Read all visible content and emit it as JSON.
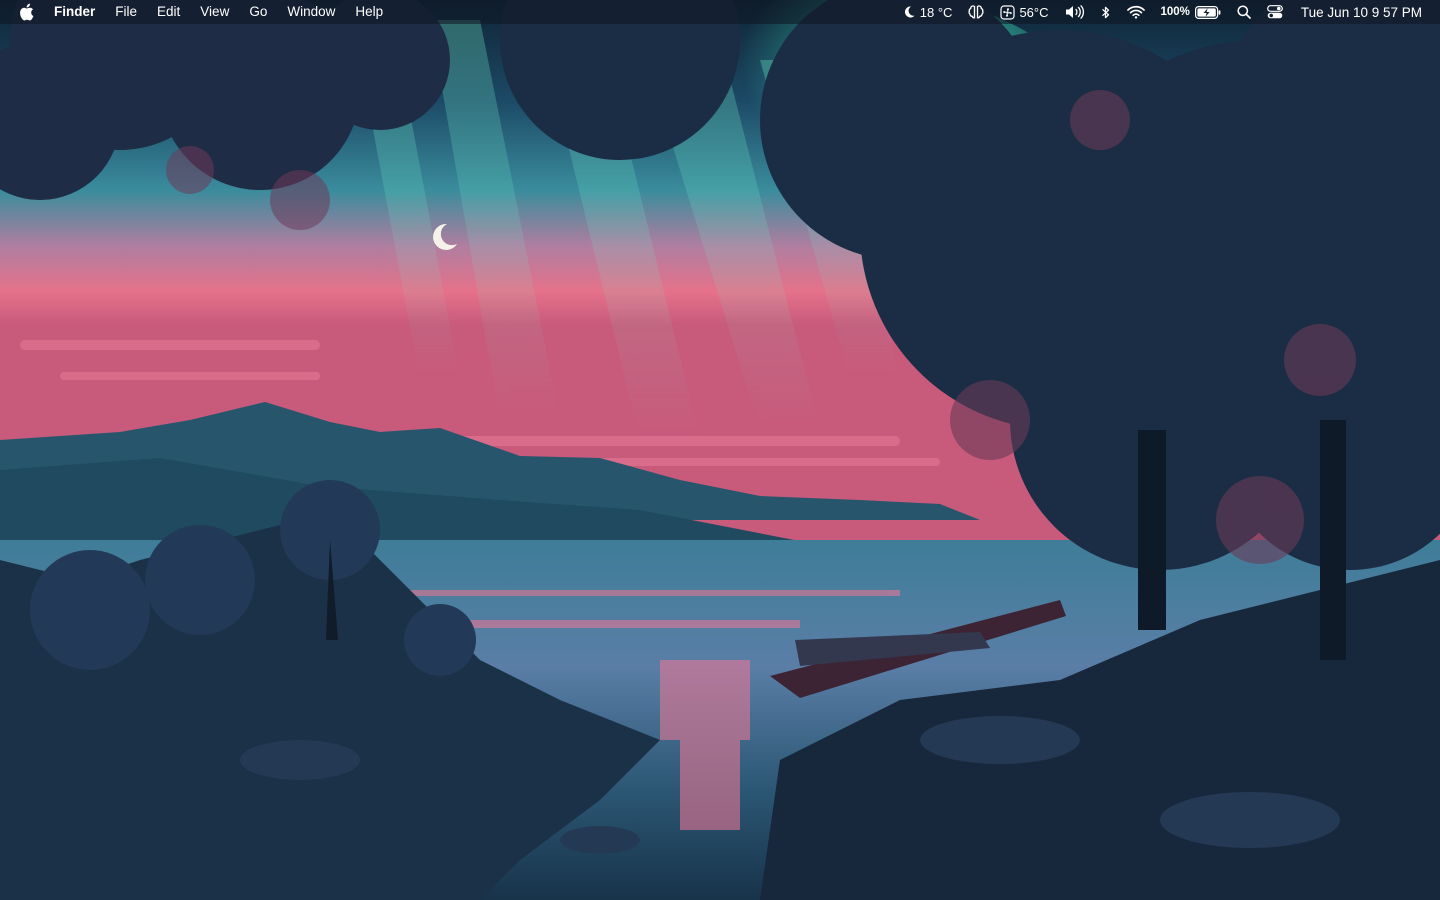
{
  "menubar": {
    "app_name": "Finder",
    "menus": [
      "File",
      "Edit",
      "View",
      "Go",
      "Window",
      "Help"
    ],
    "status": {
      "weather": {
        "icon": "moon-weather-icon",
        "temp": "18 °C"
      },
      "ai_icon": "brain-icon",
      "cpu": {
        "icon": "cpu-fan-icon",
        "temp": "56°C"
      },
      "volume_icon": "speaker-icon",
      "bluetooth_icon": "bluetooth-icon",
      "wifi_icon": "wifi-icon",
      "battery": {
        "percent": "100%",
        "charging": true
      },
      "search_icon": "spotlight-icon",
      "control_center_icon": "control-center-icon",
      "clock": "Tue Jun 10  9 57 PM"
    }
  },
  "wallpaper": {
    "description_colors": {
      "sky_teal": "#2fc6b0",
      "sky_pink": "#e86a8a",
      "water": "#3a6f8e",
      "foliage": "#1d2f45"
    }
  }
}
